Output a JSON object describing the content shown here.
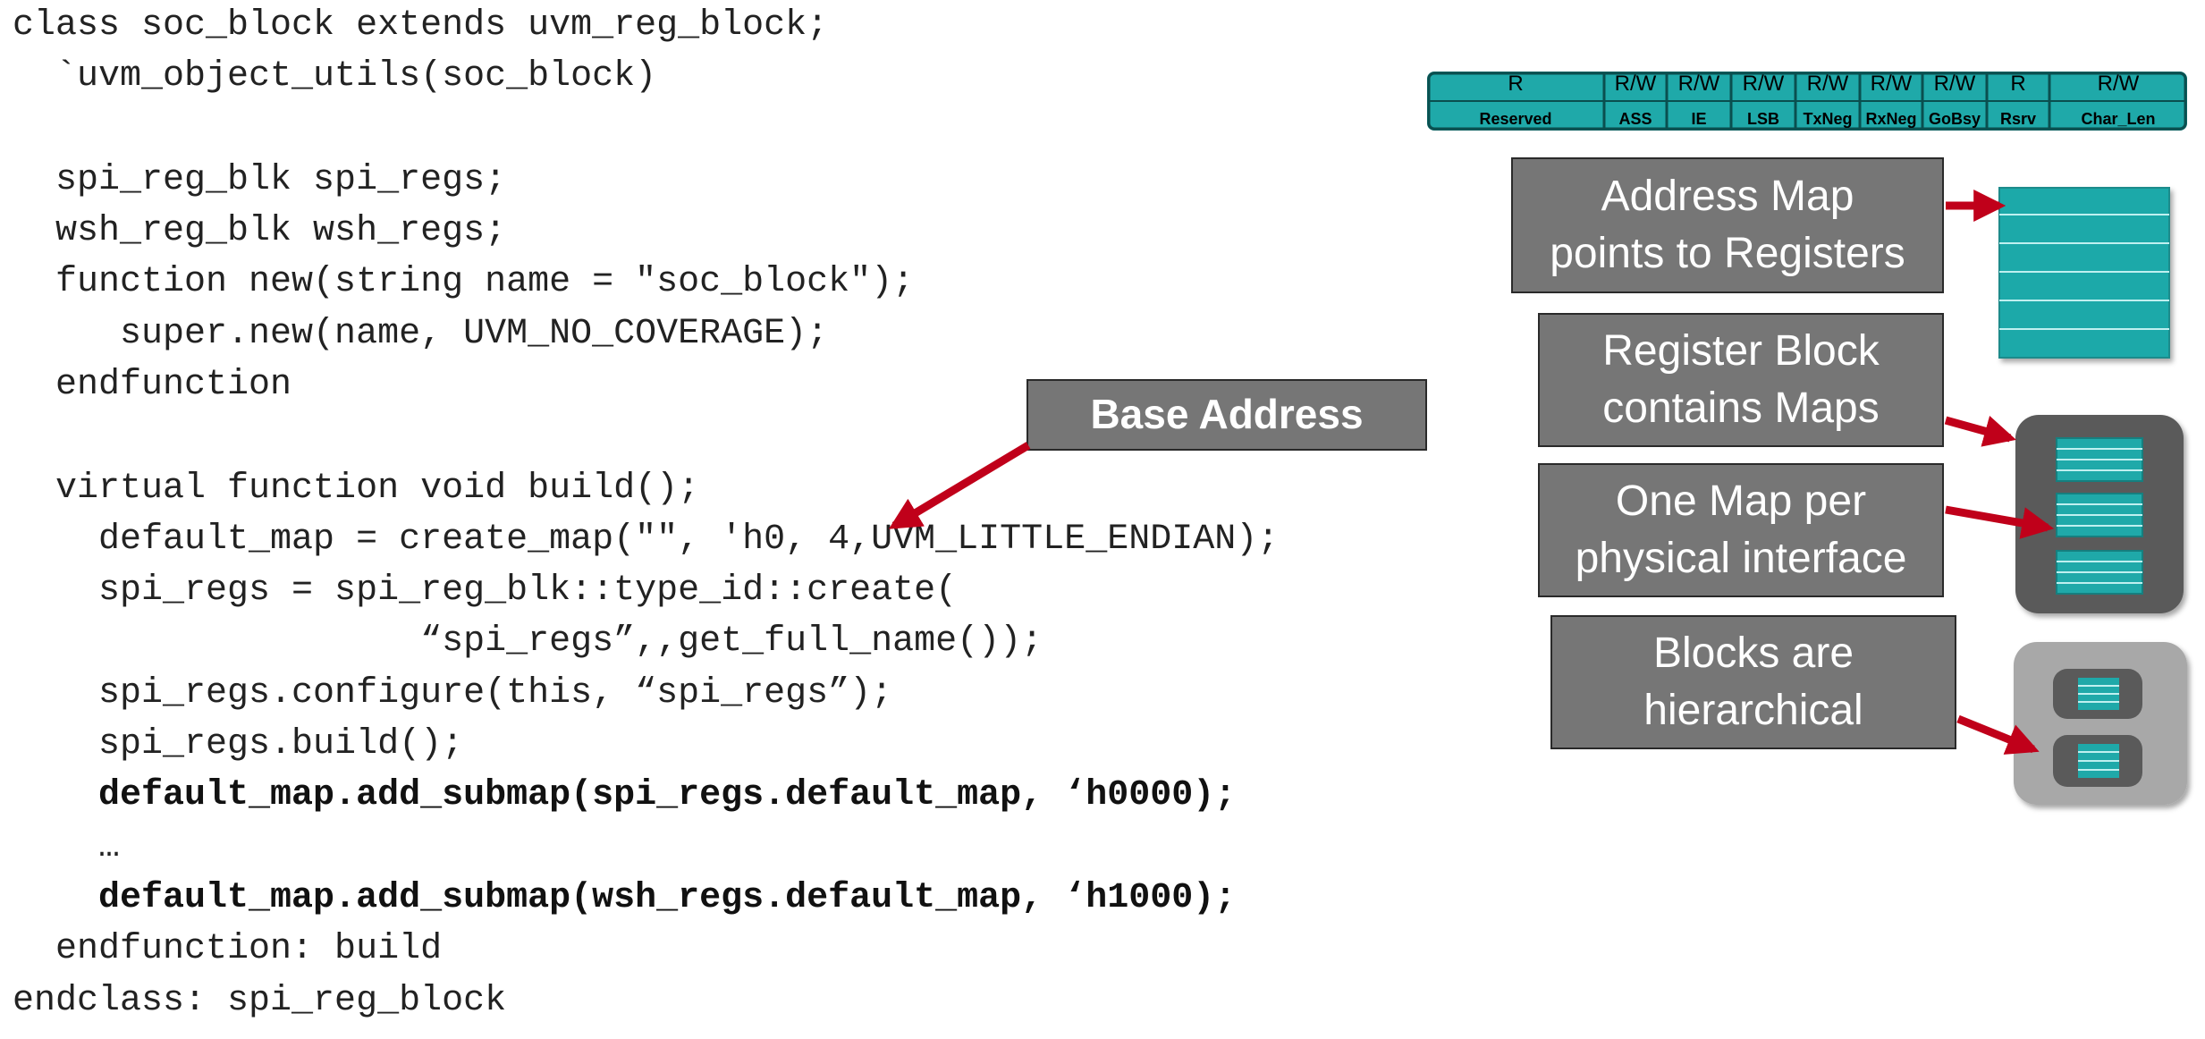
{
  "code": {
    "lines": [
      "class soc_block extends uvm_reg_block;",
      "  `uvm_object_utils(soc_block)",
      "",
      "  spi_reg_blk spi_regs;",
      "  wsh_reg_blk wsh_regs;",
      "  function new(string name = \"soc_block\");",
      "     super.new(name, UVM_NO_COVERAGE);",
      "  endfunction",
      "",
      "  virtual function void build();",
      "    default_map = create_map(\"\", 'h0, 4,UVM_LITTLE_ENDIAN);",
      "    spi_regs = spi_reg_blk::type_id::create(",
      "                   “spi_regs”,,get_full_name());",
      "    spi_regs.configure(this, “spi_regs”);",
      "    spi_regs.build();",
      "    default_map.add_submap(spi_regs.default_map, ‘h0000);",
      "    …",
      "    default_map.add_submap(wsh_regs.default_map, ‘h1000);",
      "  endfunction: build",
      "endclass: spi_reg_block"
    ]
  },
  "callouts": {
    "base_address": "Base Address",
    "address_map": [
      "Address Map",
      "points to Registers"
    ],
    "register_block": [
      "Register Block",
      "contains Maps"
    ],
    "one_map": [
      "One Map per",
      "physical interface"
    ],
    "blocks": [
      "Blocks are",
      "hierarchical"
    ]
  },
  "register_fields": [
    {
      "access": "R",
      "name": "Reserved"
    },
    {
      "access": "R/W",
      "name": "ASS"
    },
    {
      "access": "R/W",
      "name": "IE"
    },
    {
      "access": "R/W",
      "name": "LSB"
    },
    {
      "access": "R/W",
      "name": "TxNeg"
    },
    {
      "access": "R/W",
      "name": "RxNeg"
    },
    {
      "access": "R/W",
      "name": "GoBsy"
    },
    {
      "access": "R",
      "name": "Rsrv"
    },
    {
      "access": "R/W",
      "name": "Char_Len"
    }
  ],
  "colors": {
    "teal": "#1fa9a9",
    "teal_dark": "#0f6e6e",
    "callout_bg": "#767676",
    "arrow": "#c0001a",
    "block_dark": "#5a5a5a",
    "block_light": "#a8a8a8"
  }
}
